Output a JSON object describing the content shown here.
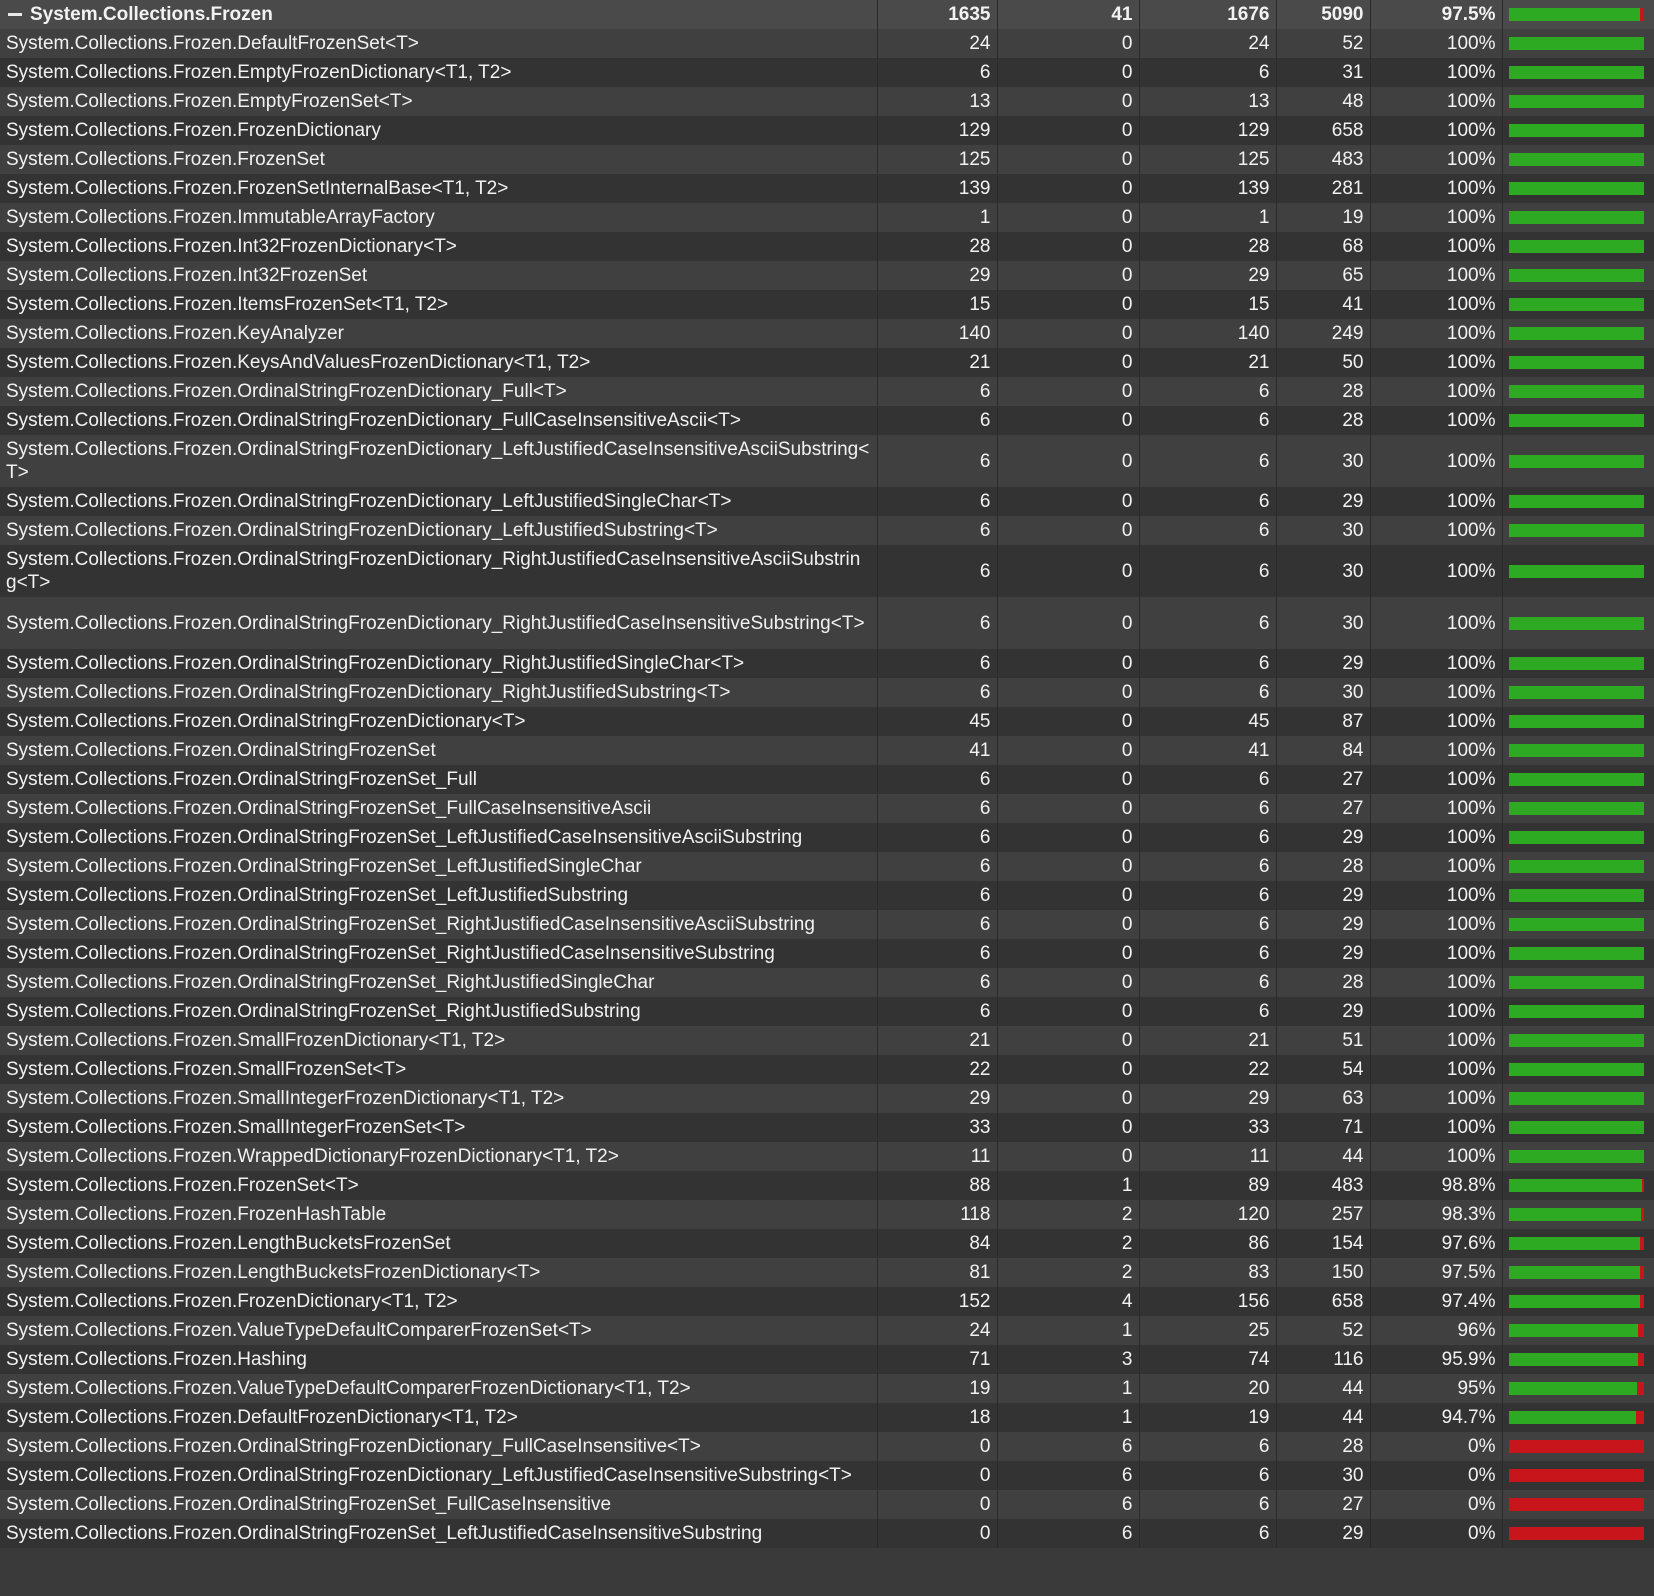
{
  "colors": {
    "covered": "#2eaa22",
    "uncovered": "#c8151b",
    "row_odd": "#404040",
    "row_even": "#333333",
    "header_bg": "#4a4a4a"
  },
  "group": {
    "toggle_icon": "collapse-minus-icon",
    "name": "System.Collections.Frozen",
    "covered": "1635",
    "uncovered": "41",
    "coverable": "1676",
    "total": "5090",
    "percent": "97.5%",
    "coverage": 0.975
  },
  "rows": [
    {
      "name": "System.Collections.Frozen.DefaultFrozenSet<T>",
      "covered": "24",
      "uncovered": "0",
      "coverable": "24",
      "total": "52",
      "percent": "100%",
      "coverage": 1
    },
    {
      "name": "System.Collections.Frozen.EmptyFrozenDictionary<T1, T2>",
      "covered": "6",
      "uncovered": "0",
      "coverable": "6",
      "total": "31",
      "percent": "100%",
      "coverage": 1
    },
    {
      "name": "System.Collections.Frozen.EmptyFrozenSet<T>",
      "covered": "13",
      "uncovered": "0",
      "coverable": "13",
      "total": "48",
      "percent": "100%",
      "coverage": 1
    },
    {
      "name": "System.Collections.Frozen.FrozenDictionary",
      "covered": "129",
      "uncovered": "0",
      "coverable": "129",
      "total": "658",
      "percent": "100%",
      "coverage": 1
    },
    {
      "name": "System.Collections.Frozen.FrozenSet",
      "covered": "125",
      "uncovered": "0",
      "coverable": "125",
      "total": "483",
      "percent": "100%",
      "coverage": 1
    },
    {
      "name": "System.Collections.Frozen.FrozenSetInternalBase<T1, T2>",
      "covered": "139",
      "uncovered": "0",
      "coverable": "139",
      "total": "281",
      "percent": "100%",
      "coverage": 1
    },
    {
      "name": "System.Collections.Frozen.ImmutableArrayFactory",
      "covered": "1",
      "uncovered": "0",
      "coverable": "1",
      "total": "19",
      "percent": "100%",
      "coverage": 1
    },
    {
      "name": "System.Collections.Frozen.Int32FrozenDictionary<T>",
      "covered": "28",
      "uncovered": "0",
      "coverable": "28",
      "total": "68",
      "percent": "100%",
      "coverage": 1
    },
    {
      "name": "System.Collections.Frozen.Int32FrozenSet",
      "covered": "29",
      "uncovered": "0",
      "coverable": "29",
      "total": "65",
      "percent": "100%",
      "coverage": 1
    },
    {
      "name": "System.Collections.Frozen.ItemsFrozenSet<T1, T2>",
      "covered": "15",
      "uncovered": "0",
      "coverable": "15",
      "total": "41",
      "percent": "100%",
      "coverage": 1
    },
    {
      "name": "System.Collections.Frozen.KeyAnalyzer",
      "covered": "140",
      "uncovered": "0",
      "coverable": "140",
      "total": "249",
      "percent": "100%",
      "coverage": 1
    },
    {
      "name": "System.Collections.Frozen.KeysAndValuesFrozenDictionary<T1, T2>",
      "covered": "21",
      "uncovered": "0",
      "coverable": "21",
      "total": "50",
      "percent": "100%",
      "coverage": 1
    },
    {
      "name": "System.Collections.Frozen.OrdinalStringFrozenDictionary_Full<T>",
      "covered": "6",
      "uncovered": "0",
      "coverable": "6",
      "total": "28",
      "percent": "100%",
      "coverage": 1
    },
    {
      "name": "System.Collections.Frozen.OrdinalStringFrozenDictionary_FullCaseInsensitiveAscii<T>",
      "covered": "6",
      "uncovered": "0",
      "coverable": "6",
      "total": "28",
      "percent": "100%",
      "coverage": 1
    },
    {
      "name": "System.Collections.Frozen.OrdinalStringFrozenDictionary_LeftJustifiedCaseInsensitiveAsciiSubstring<T>",
      "covered": "6",
      "uncovered": "0",
      "coverable": "6",
      "total": "30",
      "percent": "100%",
      "coverage": 1
    },
    {
      "name": "System.Collections.Frozen.OrdinalStringFrozenDictionary_LeftJustifiedSingleChar<T>",
      "covered": "6",
      "uncovered": "0",
      "coverable": "6",
      "total": "29",
      "percent": "100%",
      "coverage": 1
    },
    {
      "name": "System.Collections.Frozen.OrdinalStringFrozenDictionary_LeftJustifiedSubstring<T>",
      "covered": "6",
      "uncovered": "0",
      "coverable": "6",
      "total": "30",
      "percent": "100%",
      "coverage": 1
    },
    {
      "name": "System.Collections.Frozen.OrdinalStringFrozenDictionary_RightJustifiedCaseInsensitiveAsciiSubstring<T>",
      "covered": "6",
      "uncovered": "0",
      "coverable": "6",
      "total": "30",
      "percent": "100%",
      "coverage": 1
    },
    {
      "name": "System.Collections.Frozen.OrdinalStringFrozenDictionary_RightJustifiedCaseInsensitiveSubstring<T>",
      "covered": "6",
      "uncovered": "0",
      "coverable": "6",
      "total": "30",
      "percent": "100%",
      "coverage": 1
    },
    {
      "name": "System.Collections.Frozen.OrdinalStringFrozenDictionary_RightJustifiedSingleChar<T>",
      "covered": "6",
      "uncovered": "0",
      "coverable": "6",
      "total": "29",
      "percent": "100%",
      "coverage": 1
    },
    {
      "name": "System.Collections.Frozen.OrdinalStringFrozenDictionary_RightJustifiedSubstring<T>",
      "covered": "6",
      "uncovered": "0",
      "coverable": "6",
      "total": "30",
      "percent": "100%",
      "coverage": 1
    },
    {
      "name": "System.Collections.Frozen.OrdinalStringFrozenDictionary<T>",
      "covered": "45",
      "uncovered": "0",
      "coverable": "45",
      "total": "87",
      "percent": "100%",
      "coverage": 1
    },
    {
      "name": "System.Collections.Frozen.OrdinalStringFrozenSet",
      "covered": "41",
      "uncovered": "0",
      "coverable": "41",
      "total": "84",
      "percent": "100%",
      "coverage": 1
    },
    {
      "name": "System.Collections.Frozen.OrdinalStringFrozenSet_Full",
      "covered": "6",
      "uncovered": "0",
      "coverable": "6",
      "total": "27",
      "percent": "100%",
      "coverage": 1
    },
    {
      "name": "System.Collections.Frozen.OrdinalStringFrozenSet_FullCaseInsensitiveAscii",
      "covered": "6",
      "uncovered": "0",
      "coverable": "6",
      "total": "27",
      "percent": "100%",
      "coverage": 1
    },
    {
      "name": "System.Collections.Frozen.OrdinalStringFrozenSet_LeftJustifiedCaseInsensitiveAsciiSubstring",
      "covered": "6",
      "uncovered": "0",
      "coverable": "6",
      "total": "29",
      "percent": "100%",
      "coverage": 1
    },
    {
      "name": "System.Collections.Frozen.OrdinalStringFrozenSet_LeftJustifiedSingleChar",
      "covered": "6",
      "uncovered": "0",
      "coverable": "6",
      "total": "28",
      "percent": "100%",
      "coverage": 1
    },
    {
      "name": "System.Collections.Frozen.OrdinalStringFrozenSet_LeftJustifiedSubstring",
      "covered": "6",
      "uncovered": "0",
      "coverable": "6",
      "total": "29",
      "percent": "100%",
      "coverage": 1
    },
    {
      "name": "System.Collections.Frozen.OrdinalStringFrozenSet_RightJustifiedCaseInsensitiveAsciiSubstring",
      "covered": "6",
      "uncovered": "0",
      "coverable": "6",
      "total": "29",
      "percent": "100%",
      "coverage": 1
    },
    {
      "name": "System.Collections.Frozen.OrdinalStringFrozenSet_RightJustifiedCaseInsensitiveSubstring",
      "covered": "6",
      "uncovered": "0",
      "coverable": "6",
      "total": "29",
      "percent": "100%",
      "coverage": 1
    },
    {
      "name": "System.Collections.Frozen.OrdinalStringFrozenSet_RightJustifiedSingleChar",
      "covered": "6",
      "uncovered": "0",
      "coverable": "6",
      "total": "28",
      "percent": "100%",
      "coverage": 1
    },
    {
      "name": "System.Collections.Frozen.OrdinalStringFrozenSet_RightJustifiedSubstring",
      "covered": "6",
      "uncovered": "0",
      "coverable": "6",
      "total": "29",
      "percent": "100%",
      "coverage": 1
    },
    {
      "name": "System.Collections.Frozen.SmallFrozenDictionary<T1, T2>",
      "covered": "21",
      "uncovered": "0",
      "coverable": "21",
      "total": "51",
      "percent": "100%",
      "coverage": 1
    },
    {
      "name": "System.Collections.Frozen.SmallFrozenSet<T>",
      "covered": "22",
      "uncovered": "0",
      "coverable": "22",
      "total": "54",
      "percent": "100%",
      "coverage": 1
    },
    {
      "name": "System.Collections.Frozen.SmallIntegerFrozenDictionary<T1, T2>",
      "covered": "29",
      "uncovered": "0",
      "coverable": "29",
      "total": "63",
      "percent": "100%",
      "coverage": 1
    },
    {
      "name": "System.Collections.Frozen.SmallIntegerFrozenSet<T>",
      "covered": "33",
      "uncovered": "0",
      "coverable": "33",
      "total": "71",
      "percent": "100%",
      "coverage": 1
    },
    {
      "name": "System.Collections.Frozen.WrappedDictionaryFrozenDictionary<T1, T2>",
      "covered": "11",
      "uncovered": "0",
      "coverable": "11",
      "total": "44",
      "percent": "100%",
      "coverage": 1
    },
    {
      "name": "System.Collections.Frozen.FrozenSet<T>",
      "covered": "88",
      "uncovered": "1",
      "coverable": "89",
      "total": "483",
      "percent": "98.8%",
      "coverage": 0.988
    },
    {
      "name": "System.Collections.Frozen.FrozenHashTable",
      "covered": "118",
      "uncovered": "2",
      "coverable": "120",
      "total": "257",
      "percent": "98.3%",
      "coverage": 0.983
    },
    {
      "name": "System.Collections.Frozen.LengthBucketsFrozenSet",
      "covered": "84",
      "uncovered": "2",
      "coverable": "86",
      "total": "154",
      "percent": "97.6%",
      "coverage": 0.976
    },
    {
      "name": "System.Collections.Frozen.LengthBucketsFrozenDictionary<T>",
      "covered": "81",
      "uncovered": "2",
      "coverable": "83",
      "total": "150",
      "percent": "97.5%",
      "coverage": 0.975
    },
    {
      "name": "System.Collections.Frozen.FrozenDictionary<T1, T2>",
      "covered": "152",
      "uncovered": "4",
      "coverable": "156",
      "total": "658",
      "percent": "97.4%",
      "coverage": 0.974
    },
    {
      "name": "System.Collections.Frozen.ValueTypeDefaultComparerFrozenSet<T>",
      "covered": "24",
      "uncovered": "1",
      "coverable": "25",
      "total": "52",
      "percent": "96%",
      "coverage": 0.96
    },
    {
      "name": "System.Collections.Frozen.Hashing",
      "covered": "71",
      "uncovered": "3",
      "coverable": "74",
      "total": "116",
      "percent": "95.9%",
      "coverage": 0.959
    },
    {
      "name": "System.Collections.Frozen.ValueTypeDefaultComparerFrozenDictionary<T1, T2>",
      "covered": "19",
      "uncovered": "1",
      "coverable": "20",
      "total": "44",
      "percent": "95%",
      "coverage": 0.95
    },
    {
      "name": "System.Collections.Frozen.DefaultFrozenDictionary<T1, T2>",
      "covered": "18",
      "uncovered": "1",
      "coverable": "19",
      "total": "44",
      "percent": "94.7%",
      "coverage": 0.947
    },
    {
      "name": "System.Collections.Frozen.OrdinalStringFrozenDictionary_FullCaseInsensitive<T>",
      "covered": "0",
      "uncovered": "6",
      "coverable": "6",
      "total": "28",
      "percent": "0%",
      "coverage": 0
    },
    {
      "name": "System.Collections.Frozen.OrdinalStringFrozenDictionary_LeftJustifiedCaseInsensitiveSubstring<T>",
      "covered": "0",
      "uncovered": "6",
      "coverable": "6",
      "total": "30",
      "percent": "0%",
      "coverage": 0
    },
    {
      "name": "System.Collections.Frozen.OrdinalStringFrozenSet_FullCaseInsensitive",
      "covered": "0",
      "uncovered": "6",
      "coverable": "6",
      "total": "27",
      "percent": "0%",
      "coverage": 0
    },
    {
      "name": "System.Collections.Frozen.OrdinalStringFrozenSet_LeftJustifiedCaseInsensitiveSubstring",
      "covered": "0",
      "uncovered": "6",
      "coverable": "6",
      "total": "29",
      "percent": "0%",
      "coverage": 0
    }
  ]
}
